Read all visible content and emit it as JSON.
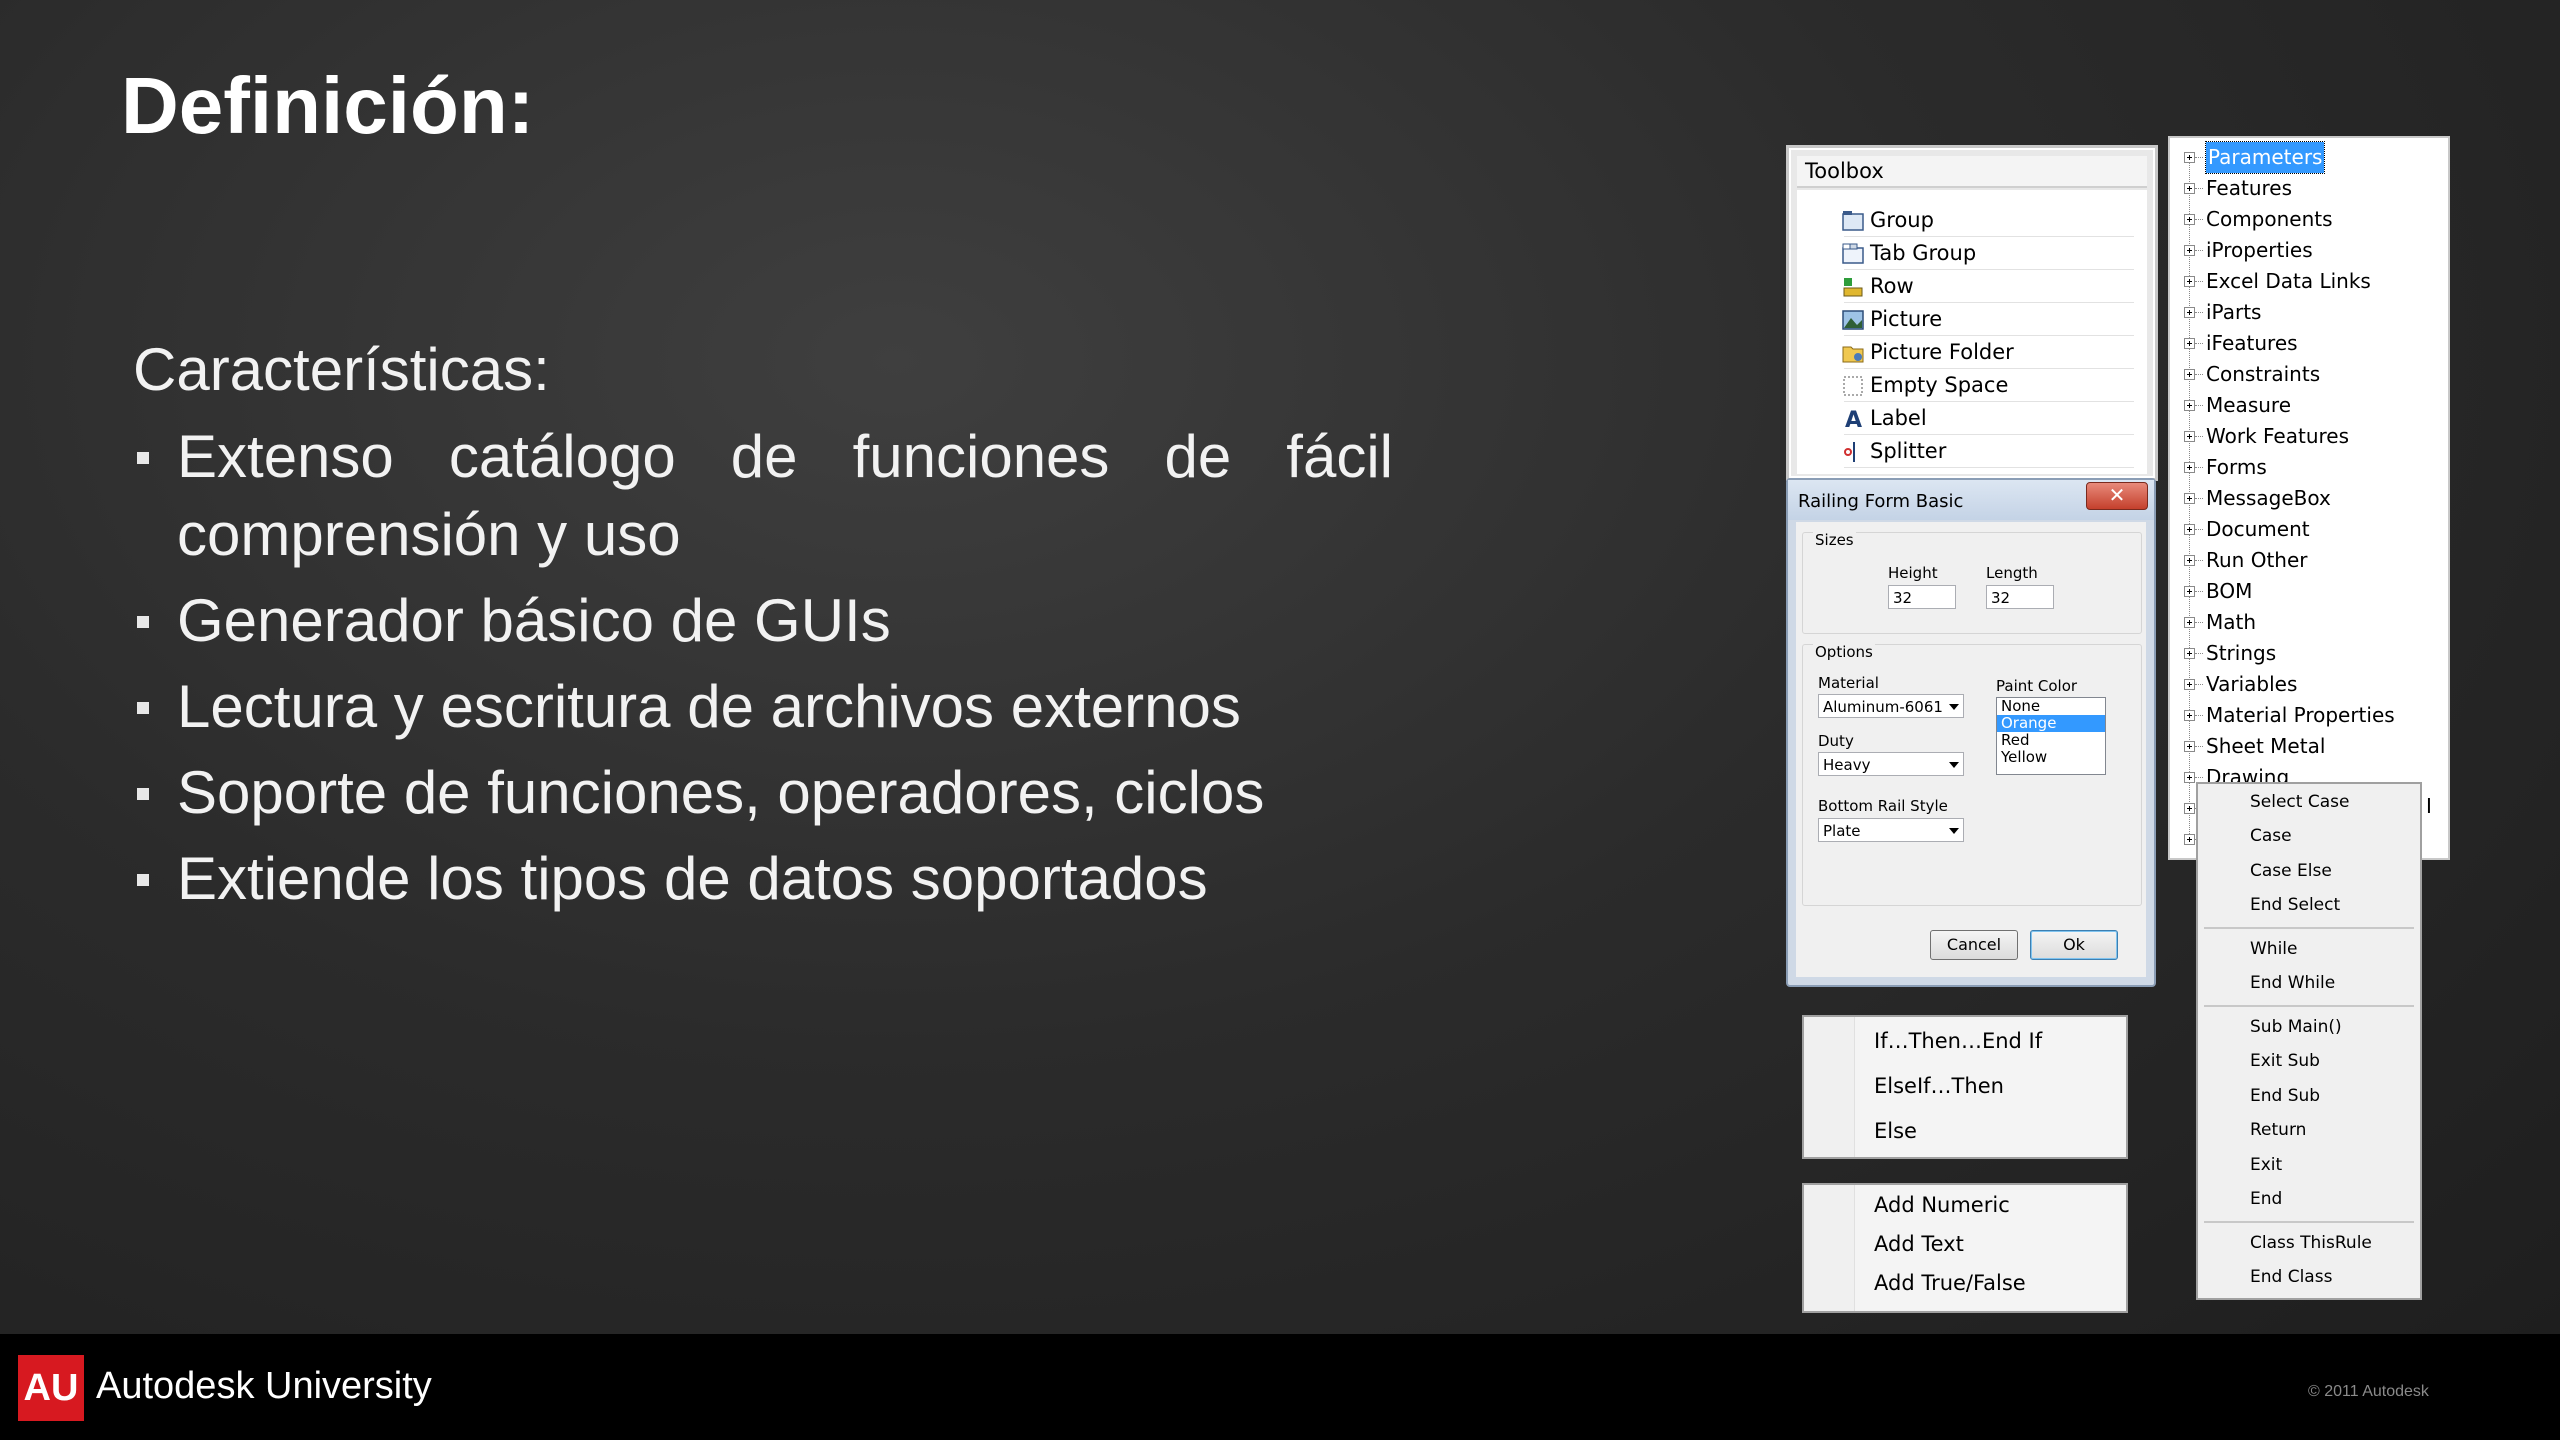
{
  "slide": {
    "title": "Definición:",
    "subhead": "Características:",
    "bullets": [
      "Extenso catálogo de funciones de fácil comprensión y uso",
      "Generador básico de GUIs",
      "Lectura y escritura de archivos externos",
      "Soporte de funciones, operadores, ciclos",
      "Extiende los tipos de datos soportados"
    ]
  },
  "toolbox": {
    "title": "Toolbox",
    "items": [
      {
        "label": "Group",
        "icon": "group-icon"
      },
      {
        "label": "Tab Group",
        "icon": "tab-group-icon"
      },
      {
        "label": "Row",
        "icon": "row-icon"
      },
      {
        "label": "Picture",
        "icon": "picture-icon"
      },
      {
        "label": "Picture Folder",
        "icon": "picture-folder-icon"
      },
      {
        "label": "Empty Space",
        "icon": "empty-space-icon"
      },
      {
        "label": "Label",
        "icon": "label-icon"
      },
      {
        "label": "Splitter",
        "icon": "splitter-icon"
      }
    ]
  },
  "dialog": {
    "title": "Railing Form Basic",
    "close": "✕",
    "sizes_caption": "Sizes",
    "height_label": "Height",
    "height_value": "32",
    "length_label": "Length",
    "length_value": "32",
    "options_caption": "Options",
    "material_label": "Material",
    "material_value": "Aluminum-6061",
    "duty_label": "Duty",
    "duty_value": "Heavy",
    "rail_label": "Bottom Rail Style",
    "rail_value": "Plate",
    "paint_label": "Paint Color",
    "paint_options": [
      "None",
      "Orange",
      "Red",
      "Yellow"
    ],
    "paint_selected": "Orange",
    "cancel": "Cancel",
    "ok": "Ok"
  },
  "if_menu": [
    "If…Then…End If",
    "ElseIf…Then",
    "Else"
  ],
  "add_menu": [
    "Add Numeric",
    "Add Text",
    "Add True/False"
  ],
  "tree": {
    "items": [
      "Parameters",
      "Features",
      "Components",
      "iProperties",
      "Excel Data Links",
      "iParts",
      "iFeatures",
      "Constraints",
      "Measure",
      "Work Features",
      "Forms",
      "MessageBox",
      "Document",
      "Run Other",
      "BOM",
      "Math",
      "Strings",
      "Variables",
      "Material Properties",
      "Sheet Metal",
      "Drawing"
    ],
    "selected": "Parameters",
    "partial": "I"
  },
  "context_menu": {
    "groups": [
      [
        "Select Case",
        "Case",
        "Case Else",
        "End Select"
      ],
      [
        "While",
        "End While"
      ],
      [
        "Sub Main()",
        "Exit Sub",
        "End Sub",
        "Return",
        "Exit",
        "End"
      ],
      [
        "Class ThisRule",
        "End Class"
      ]
    ]
  },
  "footer": {
    "logo": "AU",
    "brand": "Autodesk University",
    "copyright": "© 2011 Autodesk"
  },
  "colors": {
    "brand_red": "#d71920",
    "selection_blue": "#3399ff"
  }
}
